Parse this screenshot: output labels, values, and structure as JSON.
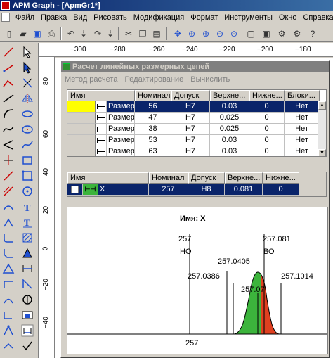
{
  "window": {
    "title": "APM Graph - [ApmGr1*]"
  },
  "menu": [
    "Файл",
    "Правка",
    "Вид",
    "Рисовать",
    "Модификация",
    "Формат",
    "Инструменты",
    "Окно",
    "Справка"
  ],
  "ruler": {
    "x_labels": [
      "−300",
      "−280",
      "−260",
      "−240",
      "−220",
      "−200",
      "−180"
    ],
    "y_labels": [
      "80",
      "60",
      "40",
      "20",
      "0",
      "−20",
      "−40"
    ]
  },
  "dialog": {
    "title": "Расчет линейных размерных цепей",
    "menu": [
      "Метод расчета",
      "Редактирование",
      "Вычислить"
    ],
    "links_table": {
      "columns": [
        "Имя",
        "Номинал",
        "Допуск",
        "Верхне...",
        "Нижне...",
        "Блоки..."
      ],
      "rows": [
        {
          "name": "Размер",
          "nominal": "56",
          "tolerance": "H7",
          "upper": "0.03",
          "lower": "0",
          "blocked": "Нет"
        },
        {
          "name": "Размер",
          "nominal": "47",
          "tolerance": "H7",
          "upper": "0.025",
          "lower": "0",
          "blocked": "Нет"
        },
        {
          "name": "Размер",
          "nominal": "38",
          "tolerance": "H7",
          "upper": "0.025",
          "lower": "0",
          "blocked": "Нет"
        },
        {
          "name": "Размер",
          "nominal": "53",
          "tolerance": "H7",
          "upper": "0.03",
          "lower": "0",
          "blocked": "Нет"
        },
        {
          "name": "Размер",
          "nominal": "63",
          "tolerance": "H7",
          "upper": "0.03",
          "lower": "0",
          "blocked": "Нет"
        }
      ]
    },
    "closing_table": {
      "columns": [
        "Имя",
        "Номинал",
        "Допуск",
        "Верхне...",
        "Нижне..."
      ],
      "row": {
        "name": "X",
        "nominal": "257",
        "tolerance": "H8",
        "upper": "0.081",
        "lower": "0"
      }
    },
    "plot": {
      "name_label": "Имя: X",
      "nominal_value": "257",
      "lower_limit_value": "257",
      "lower_limit_code": "НО",
      "upper_limit_value": "257.081",
      "upper_limit_code": "ВО",
      "inner_left_value": "257.0405",
      "outer_left_value": "257.0386",
      "center_value": "257.07",
      "outer_right_value": "257.1014",
      "colors": {
        "in_tolerance": "#3cb43c",
        "out_of_tolerance": "#e04020"
      }
    }
  }
}
